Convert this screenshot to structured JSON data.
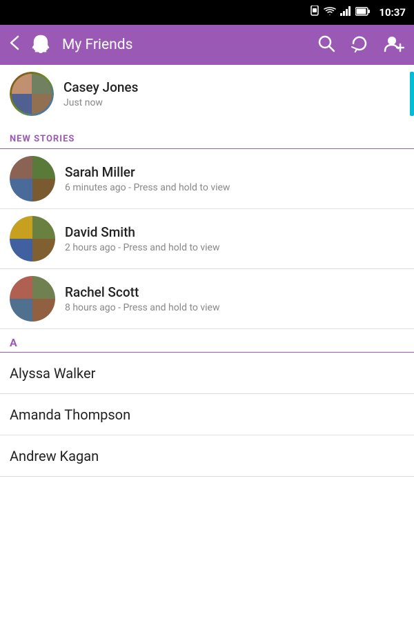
{
  "statusBar": {
    "time": "10:37",
    "icons": [
      "sim",
      "wifi",
      "signal",
      "battery"
    ]
  },
  "toolbar": {
    "title": "My Friends",
    "backLabel": "‹",
    "searchLabel": "Search",
    "refreshLabel": "Refresh",
    "addFriendLabel": "Add Friend"
  },
  "recentItem": {
    "name": "Casey Jones",
    "subtext": "Just now"
  },
  "newStoriesLabel": "NEW STORIES",
  "stories": [
    {
      "name": "Sarah Miller",
      "subtext": "6 minutes ago - Press and hold to view",
      "collageColors": [
        "#8B6355",
        "#5a7a3a",
        "#4a6a9a",
        "#7a5a30"
      ]
    },
    {
      "name": "David Smith",
      "subtext": "2 hours ago - Press and hold to view",
      "collageColors": [
        "#c8a020",
        "#6a8040",
        "#4060a0",
        "#806030"
      ]
    },
    {
      "name": "Rachel Scott",
      "subtext": "8 hours ago - Press and hold to view",
      "collageColors": [
        "#b06050",
        "#708050",
        "#507090",
        "#906040"
      ]
    }
  ],
  "alphaSection": {
    "letter": "A"
  },
  "friends": [
    {
      "name": "Alyssa Walker"
    },
    {
      "name": "Amanda Thompson"
    },
    {
      "name": "Andrew Kagan"
    }
  ]
}
